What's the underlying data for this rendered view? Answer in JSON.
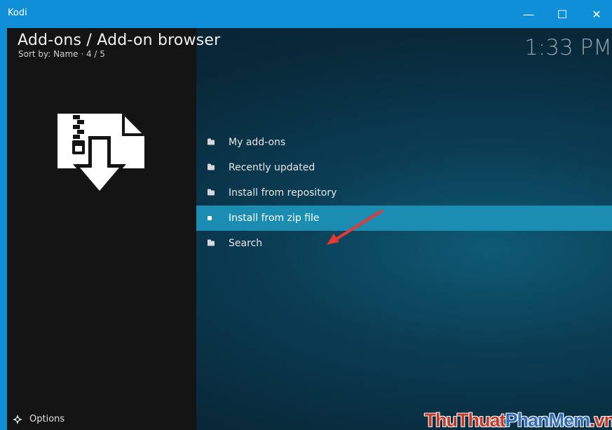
{
  "window": {
    "title": "Kodi",
    "minimize_glyph": "—",
    "maximize_glyph": "☐",
    "close_glyph": "✕"
  },
  "header": {
    "title": "Add-ons / Add-on browser",
    "subtitle": "Sort by: Name  ·  4 / 5",
    "clock": "1:33 PM"
  },
  "menu": {
    "items": [
      {
        "label": "My add-ons",
        "icon": "folder-icon"
      },
      {
        "label": "Recently updated",
        "icon": "folder-icon"
      },
      {
        "label": "Install from repository",
        "icon": "folder-icon"
      },
      {
        "label": "Install from zip file",
        "icon": "square-bullet-icon",
        "selected": true
      },
      {
        "label": "Search",
        "icon": "folder-icon"
      }
    ]
  },
  "footer": {
    "options_label": "Options",
    "options_icon": "options-icon"
  },
  "watermark": {
    "part1": "ThuThuat",
    "part2": "PhanMem",
    "part3": ".vn"
  },
  "colors": {
    "titlebar": "#0e8fd6",
    "selected_row": "#1a8db0",
    "arrow": "#e53935"
  }
}
